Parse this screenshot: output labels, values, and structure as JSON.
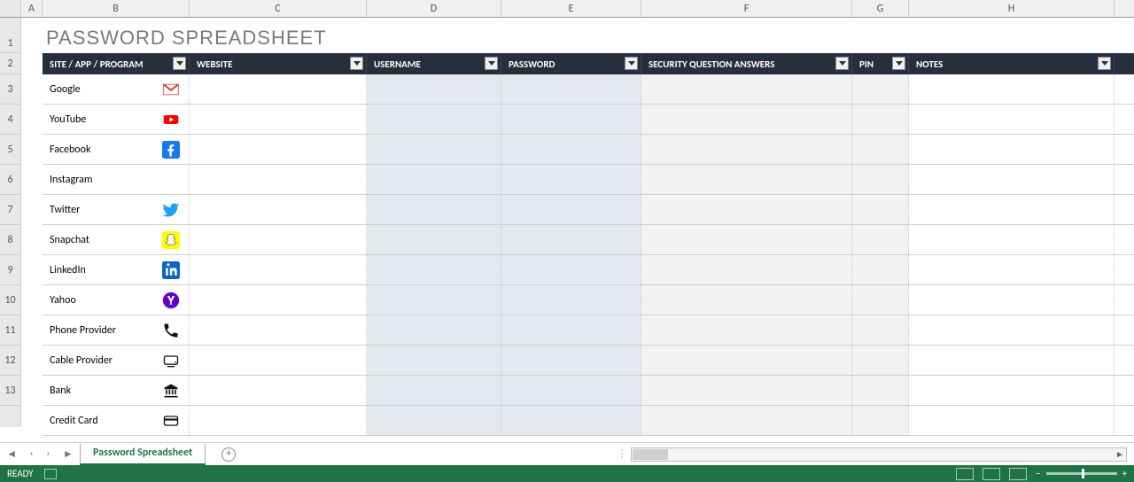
{
  "title": "PASSWORD SPREADSHEET",
  "columns_letters": [
    "A",
    "B",
    "C",
    "D",
    "E",
    "F",
    "G",
    "H"
  ],
  "row_numbers": [
    "1",
    "2",
    "3",
    "4",
    "5",
    "6",
    "7",
    "8",
    "9",
    "10",
    "11",
    "12",
    "13"
  ],
  "headers": {
    "site": "SITE / APP / PROGRAM",
    "website": "WEBSITE",
    "username": "USERNAME",
    "password": "PASSWORD",
    "security": "SECURITY QUESTION ANSWERS",
    "pin": "PIN",
    "notes": "NOTES"
  },
  "rows": [
    {
      "name": "Google",
      "icon": "gmail"
    },
    {
      "name": "YouTube",
      "icon": "youtube"
    },
    {
      "name": "Facebook",
      "icon": "facebook"
    },
    {
      "name": "Instagram",
      "icon": "instagram"
    },
    {
      "name": "Twitter",
      "icon": "twitter"
    },
    {
      "name": "Snapchat",
      "icon": "snapchat"
    },
    {
      "name": "LinkedIn",
      "icon": "linkedin"
    },
    {
      "name": "Yahoo",
      "icon": "yahoo"
    },
    {
      "name": "Phone Provider",
      "icon": "phone"
    },
    {
      "name": "Cable Provider",
      "icon": "tv"
    },
    {
      "name": "Bank",
      "icon": "bank"
    },
    {
      "name": "Credit Card",
      "icon": "card"
    }
  ],
  "sheet_tab": "Password Spreadsheet",
  "status": "READY"
}
